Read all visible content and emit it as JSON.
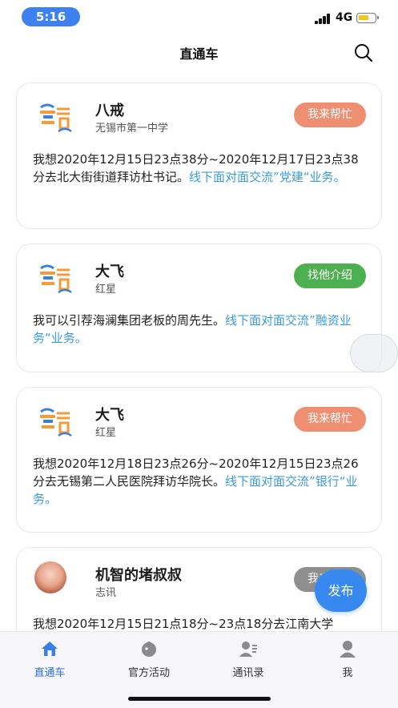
{
  "status_bar": {
    "time": "5:16",
    "network": "4G"
  },
  "nav": {
    "title": "直通车",
    "search_icon": "search-icon"
  },
  "colors": {
    "accent": "#3789f0",
    "help_button": "#ef8f72",
    "intro_button": "#4caf50",
    "link_text": "#3a9be0",
    "tab_active": "#2f73e0"
  },
  "posts": [
    {
      "name": "八戒",
      "org": "无锡市第一中学",
      "action": "我来帮忙",
      "body": "我想2020年12月15日23点38分~2020年12月17日23点38分去北大街街道拜访杜书记。",
      "link": "线下面对面交流”党建“业务。"
    },
    {
      "name": "大飞",
      "org": "红星",
      "action": "找他介绍",
      "body": "我可以引荐海澜集团老板的周先生。",
      "link": "线下面对面交流”融资业务“业务。"
    },
    {
      "name": "大飞",
      "org": "红星",
      "action": "我来帮忙",
      "body": "我想2020年12月18日23点26分~2020年12月15日23点26分去无锡第二人民医院拜访华院长。",
      "link": "线下面对面交流”银行“业务。"
    },
    {
      "name": "机智的堵叔叔",
      "org": "志讯",
      "action": "我来帮忙",
      "body": "我想2020年12月15日21点18分~23点18分去江南大学",
      "link": ""
    }
  ],
  "publish_button": "发布",
  "tabs": [
    {
      "label": "直通车",
      "icon": "home-icon",
      "active": true
    },
    {
      "label": "官方活动",
      "icon": "activity-icon",
      "active": false
    },
    {
      "label": "通讯录",
      "icon": "contacts-icon",
      "active": false
    },
    {
      "label": "我",
      "icon": "profile-icon",
      "active": false
    }
  ]
}
